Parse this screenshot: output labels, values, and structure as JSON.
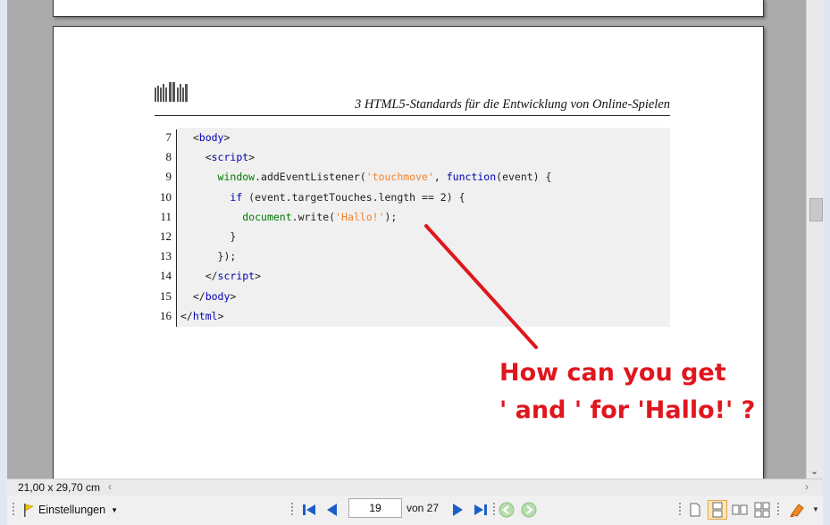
{
  "document": {
    "running_header": "3  HTML5-Standards für die Entwicklung von Online-Spielen",
    "logo": "university-logo",
    "code_listing": {
      "line_numbers": [
        "7",
        "8",
        "9",
        "10",
        "11",
        "12",
        "13",
        "14",
        "15",
        "16"
      ],
      "lines": [
        [
          {
            "t": "  <"
          },
          {
            "t": "body",
            "c": "kw"
          },
          {
            "t": ">"
          }
        ],
        [
          {
            "t": "    <"
          },
          {
            "t": "script",
            "c": "kw"
          },
          {
            "t": ">"
          }
        ],
        [
          {
            "t": "      "
          },
          {
            "t": "window",
            "c": "fn"
          },
          {
            "t": ".addEventListener("
          },
          {
            "t": "'touchmove'",
            "c": "str"
          },
          {
            "t": ", "
          },
          {
            "t": "function",
            "c": "kw"
          },
          {
            "t": "(event) {"
          }
        ],
        [
          {
            "t": "        "
          },
          {
            "t": "if",
            "c": "kw"
          },
          {
            "t": " (event.targetTouches.length == 2) {"
          }
        ],
        [
          {
            "t": "          "
          },
          {
            "t": "document",
            "c": "fn"
          },
          {
            "t": ".write("
          },
          {
            "t": "'Hallo!'",
            "c": "str"
          },
          {
            "t": ");"
          }
        ],
        [
          {
            "t": "        }"
          }
        ],
        [
          {
            "t": "      });"
          }
        ],
        [
          {
            "t": "    </"
          },
          {
            "t": "script",
            "c": "kw"
          },
          {
            "t": ">"
          }
        ],
        [
          {
            "t": "  </"
          },
          {
            "t": "body",
            "c": "kw"
          },
          {
            "t": ">"
          }
        ],
        [
          {
            "t": "</"
          },
          {
            "t": "html",
            "c": "kw"
          },
          {
            "t": ">"
          }
        ]
      ]
    }
  },
  "annotation": {
    "line1": "How can you get",
    "line2": "' and ' for 'Hallo!' ?",
    "color": "#e0161e"
  },
  "statusbar": {
    "page_size": "21,00 x 29,70 cm"
  },
  "toolbar": {
    "settings_label": "Einstellungen",
    "current_page": "19",
    "of_pages_label": "von 27",
    "icons": [
      "first-page-icon",
      "prev-page-icon",
      "next-page-icon",
      "last-page-icon",
      "back-icon",
      "forward-icon",
      "single-page-icon",
      "continuous-page-icon",
      "two-pages-icon",
      "fit-icon",
      "highlighter-icon"
    ]
  }
}
